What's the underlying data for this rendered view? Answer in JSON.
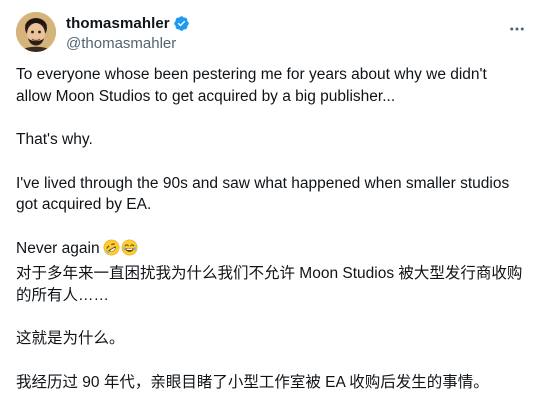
{
  "user": {
    "display_name": "thomasmahler",
    "handle": "@thomasmahler",
    "verified": true
  },
  "tweet": {
    "para1": "To everyone whose been pestering me for years about why we didn't\nallow Moon Studios to get acquired by a big publisher...",
    "para2": "That's why.",
    "para3": "I've lived through the 90s and saw what happened when smaller studios\ngot acquired by EA.",
    "para4": "Never again",
    "emojis": [
      "rolling-on-floor-laughing",
      "face-with-tears-of-joy"
    ],
    "para5": "对于多年来一直困扰我为什么我们不允许 Moon Studios 被大型发行商收购\n的所有人……",
    "para6": "这就是为什么。",
    "para7": "我经历过 90 年代，亲眼目睹了小型工作室被 EA 收购后发生的事情。"
  },
  "colors": {
    "verified": "#1d9bf0",
    "text": "#0f1419",
    "secondary": "#536471"
  }
}
